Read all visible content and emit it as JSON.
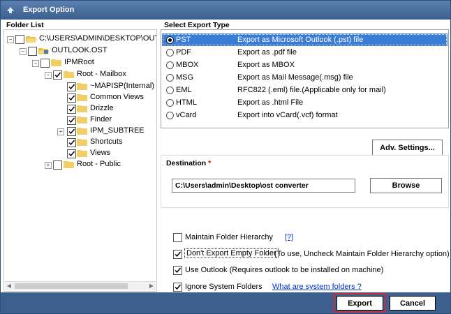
{
  "window": {
    "title": "Export Option"
  },
  "folder_list": {
    "label": "Folder List",
    "items": [
      {
        "text": "C:\\USERS\\ADMIN\\DESKTOP\\OUTLO"
      },
      {
        "text": "OUTLOOK.OST"
      },
      {
        "text": "IPMRoot"
      },
      {
        "text": "Root - Mailbox"
      },
      {
        "text": "~MAPISP(Internal)"
      },
      {
        "text": "Common Views"
      },
      {
        "text": "Drizzle"
      },
      {
        "text": "Finder"
      },
      {
        "text": "IPM_SUBTREE"
      },
      {
        "text": "Shortcuts"
      },
      {
        "text": "Views"
      },
      {
        "text": "Root - Public"
      }
    ]
  },
  "export_type": {
    "label": "Select Export Type",
    "selected": "PST",
    "options": [
      {
        "name": "PST",
        "desc": "Export as Microsoft Outlook (.pst) file"
      },
      {
        "name": "PDF",
        "desc": "Export as .pdf file"
      },
      {
        "name": "MBOX",
        "desc": "Export as MBOX"
      },
      {
        "name": "MSG",
        "desc": "Export as Mail Message(.msg) file"
      },
      {
        "name": "EML",
        "desc": "RFC822 (.eml) file.(Applicable only for mail)"
      },
      {
        "name": "HTML",
        "desc": "Export as .html File"
      },
      {
        "name": "vCard",
        "desc": "Export into vCard(.vcf) format"
      }
    ]
  },
  "adv_settings_label": "Adv. Settings...",
  "destination": {
    "label": "Destination",
    "required_mark": "*",
    "path": "C:\\Users\\admin\\Desktop\\ost converter",
    "browse_label": "Browse"
  },
  "options": {
    "maintain_hierarchy": {
      "label": "Maintain Folder Hierarchy",
      "help": "[?]",
      "checked": false
    },
    "dont_export_empty": {
      "label": "Don't Export Empty Folder",
      "note": "(To use, Uncheck Maintain Folder Hierarchy option)",
      "checked": true
    },
    "use_outlook": {
      "label": "Use Outlook (Requires outlook to be installed on machine)",
      "checked": true
    },
    "ignore_system": {
      "label": "Ignore System Folders",
      "link": "What are system folders ?",
      "checked": true
    }
  },
  "footer": {
    "export_label": "Export",
    "cancel_label": "Cancel"
  },
  "colors": {
    "titlebar": "#4a6e9e",
    "selection": "#3a7bd5",
    "footer": "#3c5f8f",
    "highlight": "#c0303e",
    "link": "#0033cc"
  }
}
